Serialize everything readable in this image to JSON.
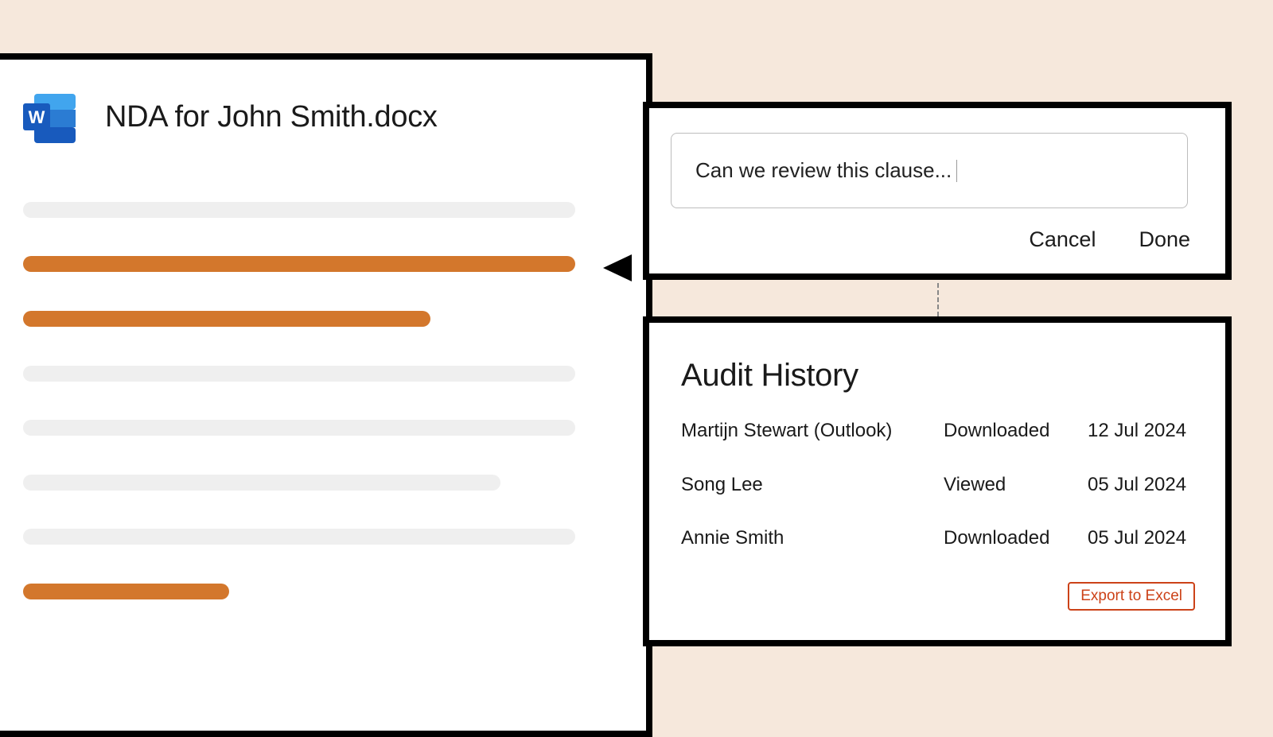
{
  "document": {
    "title": "NDA for John Smith.docx",
    "icon": "word-icon",
    "lines": [
      {
        "highlighted": false
      },
      {
        "highlighted": true
      },
      {
        "highlighted": true
      },
      {
        "highlighted": false
      },
      {
        "highlighted": false
      },
      {
        "highlighted": false
      },
      {
        "highlighted": false
      },
      {
        "highlighted": true
      }
    ]
  },
  "comment": {
    "text": "Can we review this clause...",
    "cancel_label": "Cancel",
    "done_label": "Done"
  },
  "audit": {
    "title": "Audit History",
    "rows": [
      {
        "name": "Martijn Stewart (Outlook)",
        "action": "Downloaded",
        "date": "12 Jul 2024"
      },
      {
        "name": "Song Lee",
        "action": "Viewed",
        "date": "05 Jul 2024"
      },
      {
        "name": "Annie Smith",
        "action": "Downloaded",
        "date": "05 Jul 2024"
      }
    ],
    "export_label": "Export to Excel"
  },
  "colors": {
    "background": "#f6e8dc",
    "highlight": "#d3772c",
    "placeholder_line": "#efefef",
    "export_accent": "#cc4218",
    "word_blue": "#185abd"
  }
}
